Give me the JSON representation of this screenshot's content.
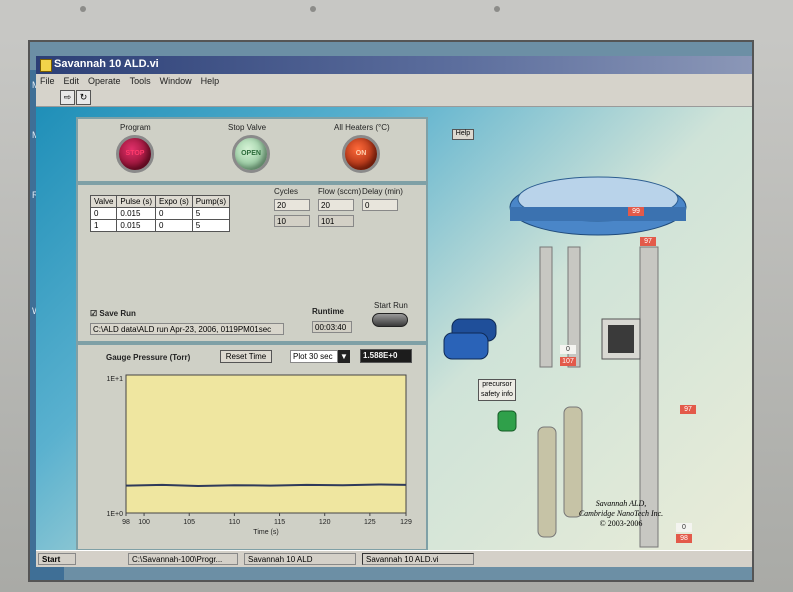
{
  "window": {
    "title": "Savannah 10 ALD.vi"
  },
  "menu": [
    "File",
    "Edit",
    "Operate",
    "Tools",
    "Window",
    "Help"
  ],
  "desktop_labels": [
    "My",
    "M",
    "R",
    "Win"
  ],
  "controls": {
    "program_label": "Program",
    "program_state": "STOP",
    "stop_valve_label": "Stop Valve",
    "stop_valve_state": "OPEN",
    "heaters_label": "All Heaters (°C)",
    "heaters_state": "ON",
    "help_button": "Help"
  },
  "valve_table": {
    "headers": [
      "Valve",
      "Pulse (s)",
      "Expo (s)",
      "Pump(s)"
    ],
    "rows": [
      [
        "0",
        "0.015",
        "0",
        "5"
      ],
      [
        "1",
        "0.015",
        "0",
        "5"
      ]
    ]
  },
  "params": {
    "cycles_label": "Cycles",
    "cycles_set": "20",
    "cycles_done": "10",
    "flow_label": "Flow (sccm)",
    "flow_set": "20",
    "flow_actual": "101",
    "delay_label": "Delay (min)",
    "delay_value": "0"
  },
  "run": {
    "save_label": "Save Run",
    "save_path": "C:\\ALD data\\ALD run Apr-23, 2006, 0119PM01sec",
    "runtime_label": "Runtime",
    "runtime_value": "00:03:40",
    "start_label": "Start Run"
  },
  "gauge": {
    "title": "Gauge Pressure (Torr)",
    "reset_button": "Reset Time",
    "plot_select": "Plot 30 sec",
    "readout": "1.588E+0"
  },
  "chart_data": {
    "type": "line",
    "title": "Gauge Pressure (Torr)",
    "xlabel": "Time (s)",
    "ylabel": "",
    "xlim": [
      98,
      129
    ],
    "y_scale": "log",
    "ylim_labels": [
      "1E+0",
      "1E+1"
    ],
    "x_ticks": [
      "98",
      "100",
      "105",
      "110",
      "115",
      "120",
      "125",
      "129"
    ],
    "x_tick_values": [
      98,
      100,
      105,
      110,
      115,
      120,
      125,
      129
    ],
    "series": [
      {
        "x": [
          98,
          102,
          106,
          110,
          114,
          118,
          122,
          126,
          129
        ],
        "y": [
          1.58,
          1.6,
          1.57,
          1.59,
          1.58,
          1.6,
          1.59,
          1.61,
          1.6
        ]
      }
    ],
    "grid": false,
    "line_color": "#2f3a5a"
  },
  "hardware": {
    "precursor_button": "precursor safety info",
    "temps": [
      {
        "top": "",
        "bottom": "99"
      },
      {
        "top": "",
        "bottom": "97"
      },
      {
        "top": "0",
        "bottom": "107"
      },
      {
        "top": "",
        "bottom": "97"
      },
      {
        "top": "0",
        "bottom": "98"
      }
    ],
    "credit_line1": "Savannah ALD,",
    "credit_line2": "Cambridge NanoTech Inc.",
    "credit_line3": "© 2003-2006"
  },
  "taskbar": {
    "start": "Start",
    "tasks": [
      "C:\\Savannah-100\\Progr...",
      "Savannah 10 ALD",
      "Savannah 10 ALD.vi"
    ]
  }
}
